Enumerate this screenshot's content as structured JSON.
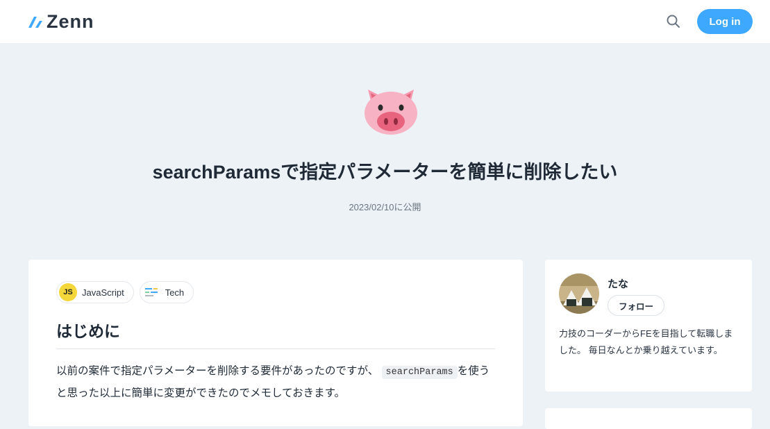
{
  "header": {
    "logo_text": "Zenn",
    "login_label": "Log in",
    "accent_color": "#3ea8ff"
  },
  "article": {
    "emoji": "pig-face",
    "title": "searchParamsで指定パラメーターを簡単に削除したい",
    "published": "2023/02/10に公開",
    "topics": [
      {
        "label": "JavaScript",
        "icon": "javascript-icon"
      },
      {
        "label": "Tech",
        "icon": "tech-icon"
      }
    ],
    "heading": "はじめに",
    "paragraph": {
      "before": "以前の案件で指定パラメーターを削除する要件があったのですが、",
      "code": "searchParams",
      "after": "を使うと思った以上に簡単に変更ができたのでメモしておきます。"
    }
  },
  "author": {
    "name": "たな",
    "follow_label": "フォロー",
    "bio": "力技のコーダーからFEを目指して転職しました。 毎日なんとか乗り越えています。"
  }
}
